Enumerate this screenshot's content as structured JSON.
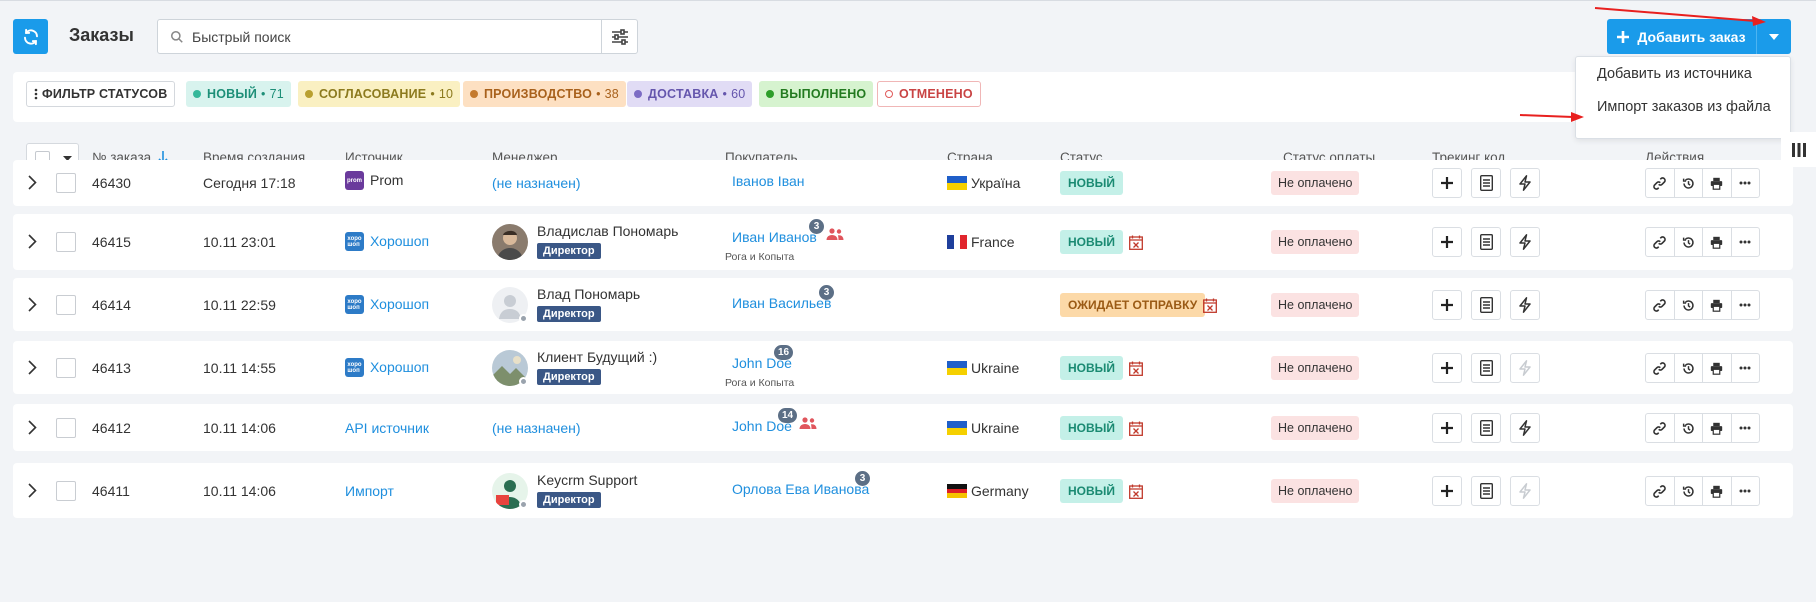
{
  "page": {
    "title": "Заказы"
  },
  "search": {
    "placeholder": "Быстрый поиск"
  },
  "add_order": {
    "label": "Добавить заказ"
  },
  "add_menu": [
    {
      "label": "Добавить из источника"
    },
    {
      "label": "Импорт заказов из файла"
    }
  ],
  "status_filter": {
    "filter_label": "ФИЛЬТР СТАТУСОВ",
    "chips": [
      {
        "label": "НОВЫЙ",
        "count": "71",
        "bg": "#d8f3ee",
        "dot": "#35b89a",
        "color": "#1e8f78"
      },
      {
        "label": "СОГЛАСОВАНИЕ",
        "count": "10",
        "bg": "#faf0c2",
        "dot": "#b9a030",
        "color": "#8c7a1e"
      },
      {
        "label": "ПРОИЗВОДСТВО",
        "count": "38",
        "bg": "#fde0c2",
        "dot": "#c47a2e",
        "color": "#a8611c"
      },
      {
        "label": "ДОСТАВКА",
        "count": "60",
        "bg": "#e1dcf5",
        "dot": "#7c6cc4",
        "color": "#6556ad"
      },
      {
        "label": "ВЫПОЛНЕНО",
        "count": "",
        "bg": "#d6f3cf",
        "dot": "#2e9e2a",
        "color": "#237a20"
      },
      {
        "label": "ОТМЕНЕНО",
        "count": "",
        "bg": "#ffffff",
        "dot": "#e05a5a",
        "color": "#c94444"
      }
    ]
  },
  "columns": {
    "order_no": "№ заказа",
    "created": "Время создания",
    "source": "Источник",
    "manager": "Менеджер",
    "buyer": "Покупатель",
    "country": "Страна",
    "status": "Статус",
    "payment": "Статус оплаты",
    "tracking": "Трекинг код",
    "actions": "Действия"
  },
  "orders": [
    {
      "id": "46430",
      "created": "Сегодня 17:18",
      "source": "Prom",
      "manager": "(не назначен)",
      "role": "",
      "buyer": "Іванов Іван",
      "buyer_count": "",
      "company": "",
      "country": "Україна",
      "status": "НОВЫЙ",
      "payment": "Не оплачено"
    },
    {
      "id": "46415",
      "created": "10.11 23:01",
      "source": "Хорошоп",
      "manager": "Владислав Пономарь",
      "role": "Директор",
      "buyer": "Иван Иванов",
      "buyer_count": "3",
      "company": "Рога и Копыта",
      "country": "France",
      "status": "НОВЫЙ",
      "payment": "Не оплачено"
    },
    {
      "id": "46414",
      "created": "10.11 22:59",
      "source": "Хорошоп",
      "manager": "Влад Пономарь",
      "role": "Директор",
      "buyer": "Иван Васильев",
      "buyer_count": "3",
      "company": "",
      "country": "",
      "status": "ОЖИДАЕТ ОТПРАВКУ",
      "payment": "Не оплачено"
    },
    {
      "id": "46413",
      "created": "10.11 14:55",
      "source": "Хорошоп",
      "manager": "Клиент Будущий :)",
      "role": "Директор",
      "buyer": "John Doe",
      "buyer_count": "16",
      "company": "Рога и Копыта",
      "country": "Ukraine",
      "status": "НОВЫЙ",
      "payment": "Не оплачено"
    },
    {
      "id": "46412",
      "created": "10.11 14:06",
      "source": "API источник",
      "manager": "(не назначен)",
      "role": "",
      "buyer": "John Doe",
      "buyer_count": "14",
      "company": "",
      "country": "Ukraine",
      "status": "НОВЫЙ",
      "payment": "Не оплачено"
    },
    {
      "id": "46411",
      "created": "10.11 14:06",
      "source": "Импорт",
      "manager": "Keycrm Support",
      "role": "Директор",
      "buyer": "Орлова Ева Иванова",
      "buyer_count": "3",
      "company": "",
      "country": "Germany",
      "status": "НОВЫЙ",
      "payment": "Не оплачено"
    }
  ],
  "icons": {
    "refresh": "refresh-icon",
    "search": "search-icon",
    "filter": "sliders-icon",
    "expand": "chevron-right-icon",
    "add_tracking": "plus-icon",
    "document": "document-icon",
    "lightning": "lightning-icon",
    "link": "link-icon",
    "history": "history-icon",
    "print": "print-icon",
    "more": "more-icon"
  },
  "colors": {
    "accent": "#1a9bea",
    "link": "#1f8fde",
    "status_new_bg": "#c4f0e8",
    "status_waiting_bg": "#fcd9a8",
    "payment_bg": "#fbe2e2",
    "role_badge": "#3a5786",
    "annotation_arrow": "#e8201f"
  }
}
